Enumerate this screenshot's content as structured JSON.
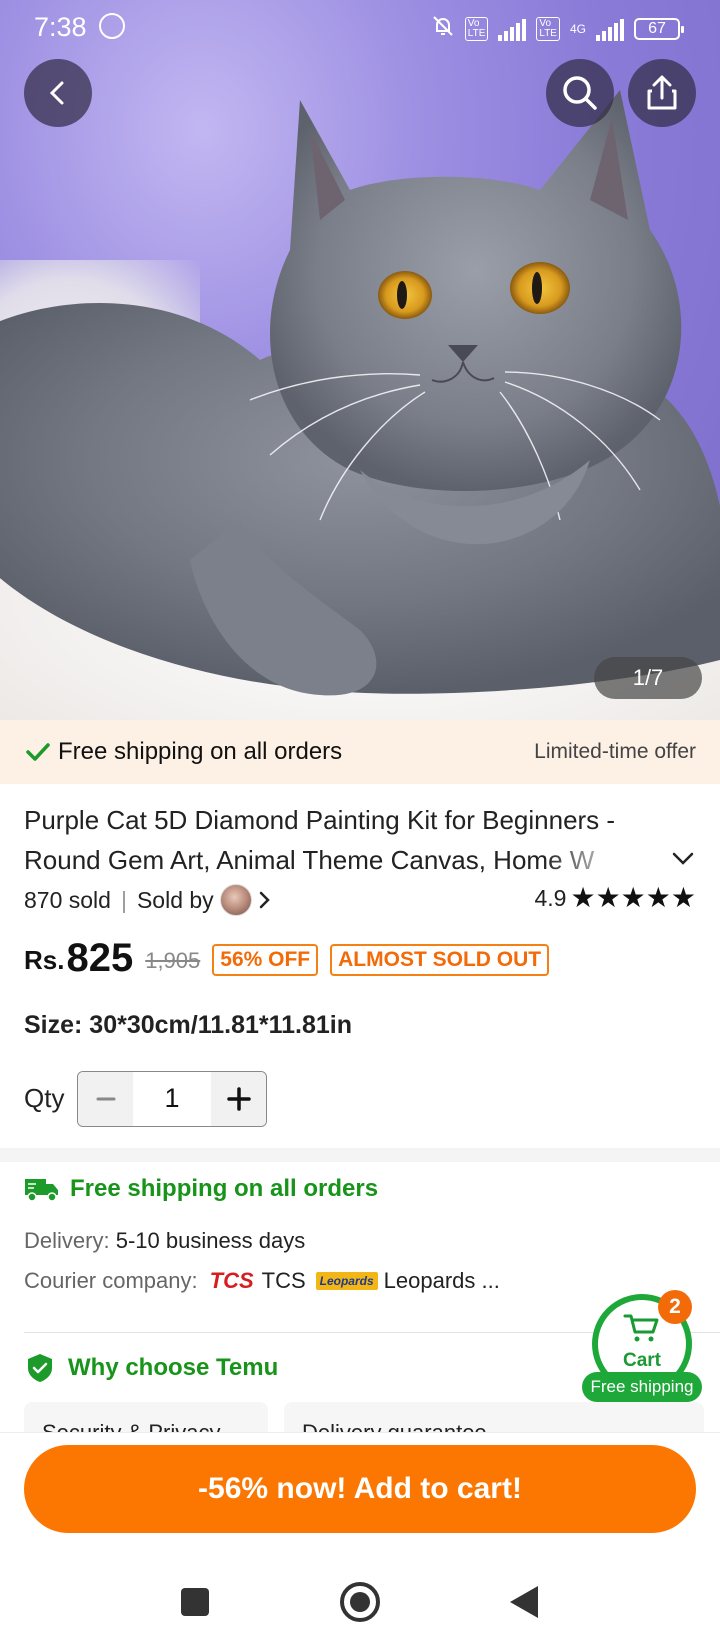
{
  "status_bar": {
    "time": "7:38",
    "battery": "67",
    "network": "4G"
  },
  "gallery": {
    "counter": "1/7"
  },
  "shipping_banner": {
    "text": "Free shipping on all orders",
    "offer": "Limited-time offer"
  },
  "product": {
    "title": "Purple Cat 5D Diamond Painting Kit for Beginners - Round Gem Art, Animal Theme Canvas, Home W",
    "sold": "870 sold",
    "sold_by": "Sold by",
    "rating": "4.9",
    "currency": "Rs.",
    "price": "825",
    "old_price": "1,905",
    "discount_tag": "56% OFF",
    "stock_tag": "ALMOST SOLD OUT",
    "size_label": "Size: 30*30cm/11.81*11.81in",
    "qty_label": "Qty",
    "qty_value": "1"
  },
  "shipping_section": {
    "title": "Free shipping on all orders",
    "delivery_label": "Delivery:",
    "delivery_value": "5-10 business days",
    "courier_label": "Courier company:",
    "courier_tcs_logo": "TCS",
    "courier_tcs": "TCS",
    "courier_leo_logo": "Leopards",
    "courier_leo": "Leopards ..."
  },
  "why_section": {
    "title": "Why choose Temu",
    "cards": [
      "Security & Privacy",
      "Delivery guarantee"
    ]
  },
  "cart": {
    "label": "Cart",
    "badge": "2",
    "free_shipping": "Free shipping"
  },
  "cta": {
    "label": "-56% now! Add to cart!"
  },
  "colors": {
    "accent_orange": "#fb7701",
    "green": "#18941a",
    "banner_bg": "#fdf1e6"
  }
}
